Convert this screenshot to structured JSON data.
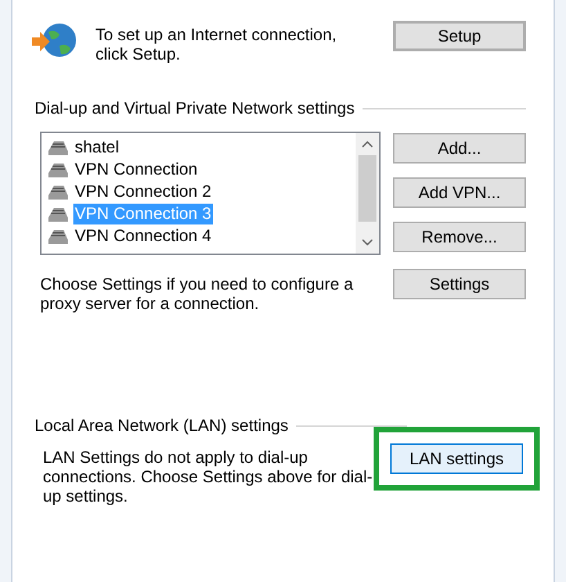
{
  "setup": {
    "text": "To set up an Internet connection, click Setup.",
    "button": {
      "label": "Setup",
      "focused": true
    }
  },
  "dialup": {
    "heading": "Dial-up and Virtual Private Network settings",
    "connections": [
      {
        "name": "shatel",
        "selected": false
      },
      {
        "name": "VPN Connection",
        "selected": false
      },
      {
        "name": "VPN Connection 2",
        "selected": false
      },
      {
        "name": "VPN Connection 3",
        "selected": true
      },
      {
        "name": "VPN Connection 4",
        "selected": false
      }
    ],
    "buttons": [
      "Add...",
      "Add VPN...",
      "Remove..."
    ],
    "proxy_text": "Choose Settings if you need to configure a proxy server for a connection.",
    "settings_button": "Settings"
  },
  "lan": {
    "heading": "Local Area Network (LAN) settings",
    "text": "LAN Settings do not apply to dial-up connections. Choose Settings above for dial-up settings.",
    "button": {
      "label": "LAN settings",
      "highlighted": true
    }
  }
}
